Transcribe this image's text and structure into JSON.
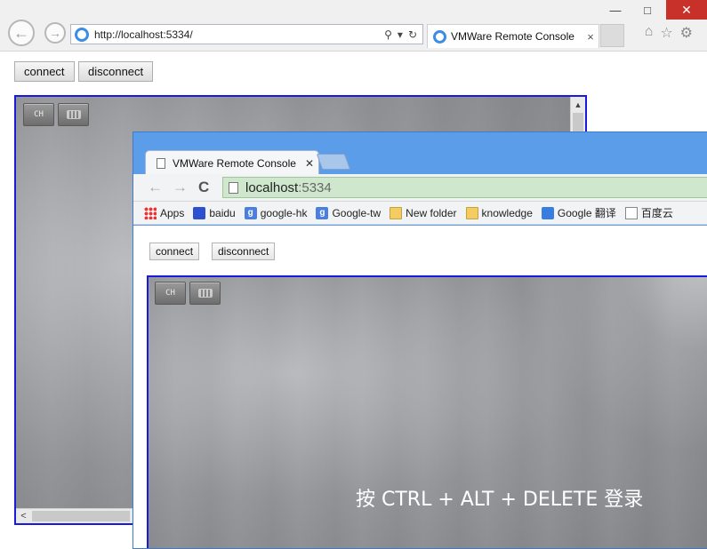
{
  "outer_browser": {
    "address_url": "http://localhost:5334/",
    "tab_title": "VMWare Remote Console",
    "tab_close": "×",
    "window_controls": {
      "minimize": "—",
      "maximize": "□",
      "close": "✕"
    },
    "icons": [
      "back-icon",
      "forward-icon",
      "ie-logo-icon",
      "search-icon",
      "dropdown-icon",
      "refresh-icon",
      "home-icon",
      "favorites-star-icon",
      "settings-gear-icon"
    ]
  },
  "outer_page": {
    "connect_label": "connect",
    "disconnect_label": "disconnect"
  },
  "outer_console": {
    "lang_button": "CH",
    "scroll_up": "▲",
    "scroll_left": "<"
  },
  "inner_browser": {
    "tab_title": "VMWare Remote Console",
    "tab_close": "✕",
    "nav_back": "←",
    "nav_forward": "→",
    "nav_reload": "C",
    "omnibox_host": "localhost",
    "omnibox_port": ":5334",
    "bookmarks": [
      {
        "label": "Apps",
        "icon": "apps-grid-icon"
      },
      {
        "label": "baidu",
        "icon": "baidu-paw-icon"
      },
      {
        "label": "google-hk",
        "icon": "google-icon"
      },
      {
        "label": "Google-tw",
        "icon": "google-icon"
      },
      {
        "label": "New folder",
        "icon": "folder-icon"
      },
      {
        "label": "knowledge",
        "icon": "folder-icon"
      },
      {
        "label": "Google 翻译",
        "icon": "google-translate-icon"
      },
      {
        "label": "百度云",
        "icon": "document-icon"
      }
    ]
  },
  "inner_page": {
    "connect_label": "connect",
    "disconnect_label": "disconnect"
  },
  "inner_console": {
    "lang_button": "CH",
    "login_message": "按 CTRL + ALT + DELETE 登录"
  },
  "colors": {
    "console_border": "#1a1adb",
    "chrome_frame": "#5b9de8",
    "omnibox_bg": "#cfe8cd",
    "ie_close": "#c7312a"
  }
}
